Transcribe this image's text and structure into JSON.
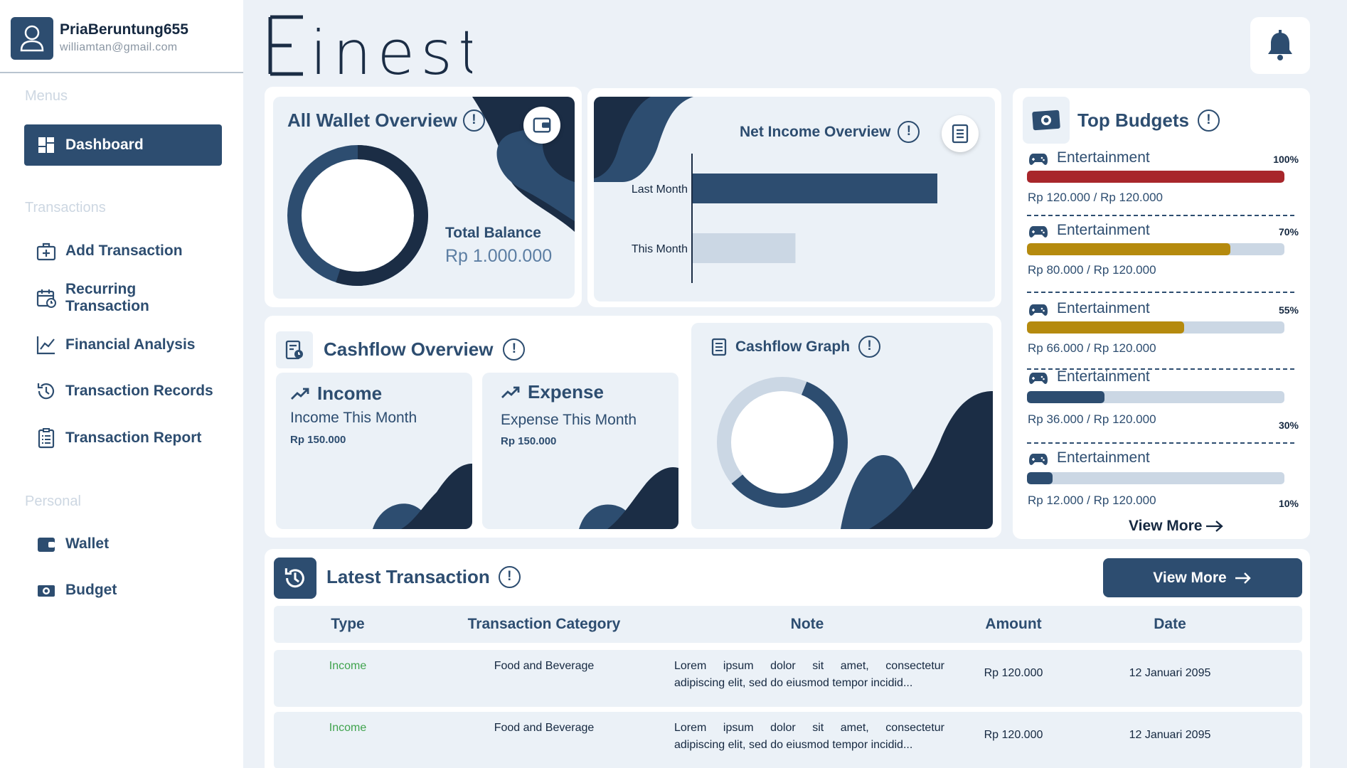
{
  "profile": {
    "username": "PriaBeruntung655",
    "email": "williamtan@gmail.com"
  },
  "logo": {
    "text": "Finest"
  },
  "sidebar": {
    "menus_label": "Menus",
    "transactions_label": "Transactions",
    "personal_label": "Personal",
    "items": [
      {
        "label": "Dashboard",
        "icon": "dashboard-icon",
        "active": true
      },
      {
        "label": "Add Transaction",
        "icon": "add-transaction-icon"
      },
      {
        "label": "Recurring Transaction",
        "icon": "calendar-repeat-icon"
      },
      {
        "label": "Financial Analysis",
        "icon": "line-chart-icon"
      },
      {
        "label": "Transaction Records",
        "icon": "history-icon"
      },
      {
        "label": "Transaction Report",
        "icon": "report-icon"
      },
      {
        "label": "Wallet",
        "icon": "wallet-icon"
      },
      {
        "label": "Budget",
        "icon": "money-icon"
      }
    ]
  },
  "wallet_overview": {
    "title": "All Wallet Overview",
    "info": "!",
    "total_label": "Total Balance",
    "total_value": "Rp 1.000.000",
    "donut_fraction": 0.55
  },
  "net_income": {
    "title": "Net Income Overview",
    "info": "!",
    "chart_data": {
      "type": "bar",
      "orientation": "horizontal",
      "categories": [
        "Last Month",
        "This Month"
      ],
      "values": [
        100,
        42
      ],
      "title": "Net Income Overview"
    }
  },
  "cashflow": {
    "title": "Cashflow Overview",
    "info": "!",
    "income": {
      "title": "Income",
      "subtitle": "Income This Month",
      "value": "Rp 150.000"
    },
    "expense": {
      "title": "Expense",
      "subtitle": "Expense This Month",
      "value": "Rp 150.000"
    },
    "graph_title": "Cashflow Graph",
    "graph_info": "!",
    "donut_fraction": 0.58
  },
  "top_budgets": {
    "title": "Top Budgets",
    "info": "!",
    "items": [
      {
        "name": "Entertainment",
        "percent": "100%",
        "fraction": 1.0,
        "amount": "Rp 120.000 / Rp 120.000",
        "color": "#a8262b"
      },
      {
        "name": "Entertainment",
        "percent": "70%",
        "fraction": 0.79,
        "amount": "Rp 80.000 / Rp 120.000",
        "color": "#b58a0e"
      },
      {
        "name": "Entertainment",
        "percent": "55%",
        "fraction": 0.61,
        "amount": "Rp 66.000 / Rp 120.000",
        "color": "#b58a0e"
      },
      {
        "name": "Entertainment",
        "percent": "30%",
        "fraction": 0.3,
        "amount": "Rp 36.000 / Rp 120.000",
        "color": "#2d4d70"
      },
      {
        "name": "Entertainment",
        "percent": "10%",
        "fraction": 0.1,
        "amount": "Rp 12.000 / Rp 120.000",
        "color": "#2d4d70"
      }
    ],
    "view_more": "View More"
  },
  "latest": {
    "title": "Latest Transaction",
    "info": "!",
    "view_more": "View More",
    "columns": [
      "Type",
      "Transaction Category",
      "Note",
      "Amount",
      "Date"
    ],
    "rows": [
      {
        "type": "Income",
        "category": "Food and Beverage",
        "note1": "Lorem ipsum dolor sit amet, consectetur",
        "note2": "adipiscing elit, sed do eiusmod tempor incidid...",
        "amount": "Rp 120.000",
        "date": "12 Januari 2095"
      },
      {
        "type": "Income",
        "category": "Food and Beverage",
        "note1": "Lorem ipsum dolor sit amet, consectetur",
        "note2": "adipiscing elit, sed do eiusmod tempor incidid...",
        "amount": "Rp 120.000",
        "date": "12 Januari 2095"
      }
    ]
  },
  "colors": {
    "primary": "#2d4d70",
    "dark": "#1b2d45",
    "income": "#3fa34d",
    "danger": "#a8262b",
    "warning": "#b58a0e"
  }
}
